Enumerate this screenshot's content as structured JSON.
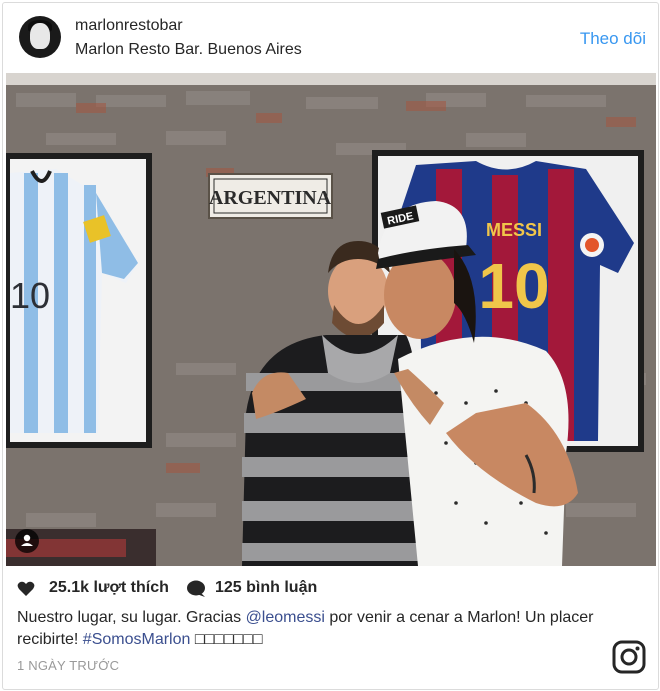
{
  "post": {
    "username": "marlonrestobar",
    "location": "Marlon Resto Bar. Buenos Aires",
    "follow_label": "Theo dõi",
    "likes_text": "25.1k lượt thích",
    "comments_text": "125 bình luận",
    "caption_part1": "Nuestro lugar, su lugar. Gracias ",
    "mention": "@leomessi",
    "caption_part2": " por venir a cenar a Marlon! Un placer recibirte! ",
    "hashtag": "#SomosMarlon",
    "caption_tail": " □□□□□□□",
    "timestamp": "1 NGÀY TRƯỚC"
  },
  "photo": {
    "sign_text": "ARGENTINA",
    "jersey_left_number": "10",
    "jersey_right_name": "MESSI",
    "jersey_right_number": "10",
    "cap_text": "RIDE"
  },
  "icons": {
    "avatar": "avatar-portrait-icon",
    "like": "heart-icon",
    "comment": "comment-bubble-icon",
    "user_tag": "person-tag-icon",
    "brand": "instagram-logo-icon"
  },
  "colors": {
    "link_blue": "#3897f0",
    "mention_color": "#3b4f8f",
    "timestamp_gray": "#999999"
  }
}
